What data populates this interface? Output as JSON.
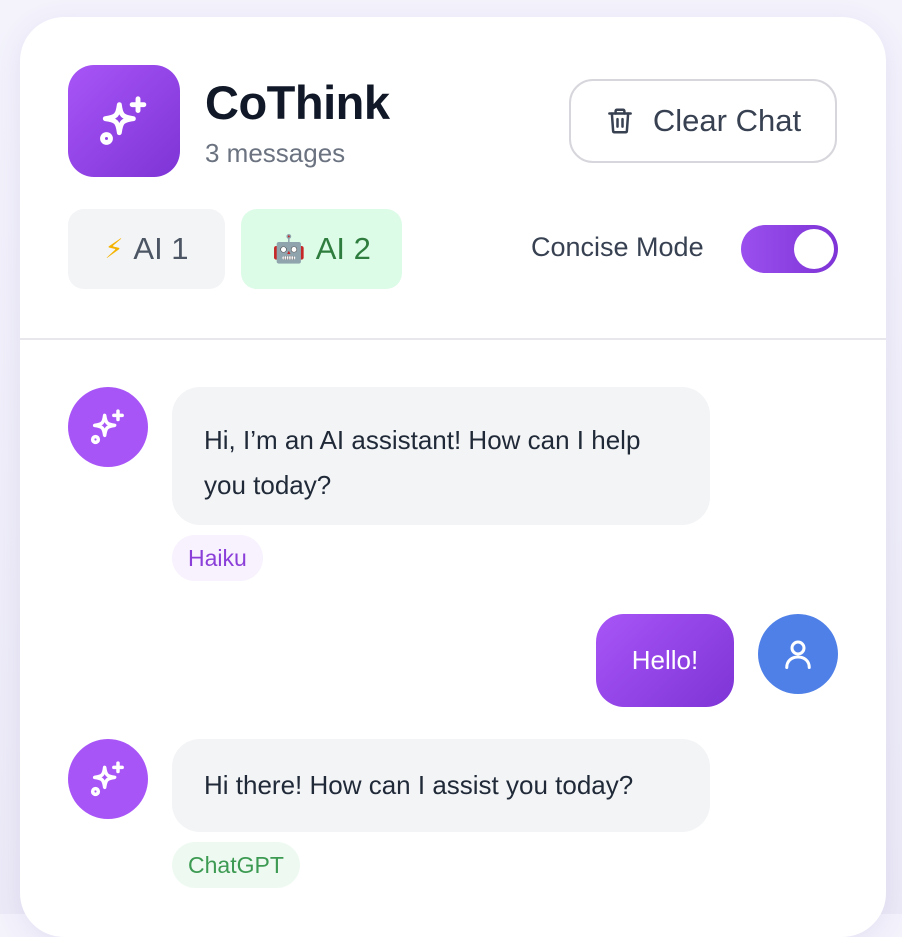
{
  "app": {
    "title": "CoThink",
    "message_count": "3 messages",
    "brand_color": "#a855f7"
  },
  "header": {
    "clear_chat_label": "Clear Chat",
    "clear_chat_icon": "trash-icon",
    "ai_options": [
      {
        "emoji": "⚡",
        "label": "AI 1",
        "active": false
      },
      {
        "emoji": "🤖",
        "label": "AI 2",
        "active": true
      }
    ],
    "concise_mode": {
      "label": "Concise Mode",
      "enabled": true
    }
  },
  "messages": [
    {
      "role": "assistant",
      "text": "Hi, I’m an AI assistant! How can I help you today?",
      "model": "Haiku"
    },
    {
      "role": "user",
      "text": "Hello!"
    },
    {
      "role": "assistant",
      "text": "Hi there! How can I assist you today?",
      "model": "ChatGPT"
    }
  ],
  "colors": {
    "ai_avatar": "#a855f7",
    "user_avatar": "#4f80e8",
    "ai2_active_bg": "#dcfce7",
    "haiku_tag": "#8b3fd9",
    "chatgpt_tag": "#3c9a52"
  }
}
